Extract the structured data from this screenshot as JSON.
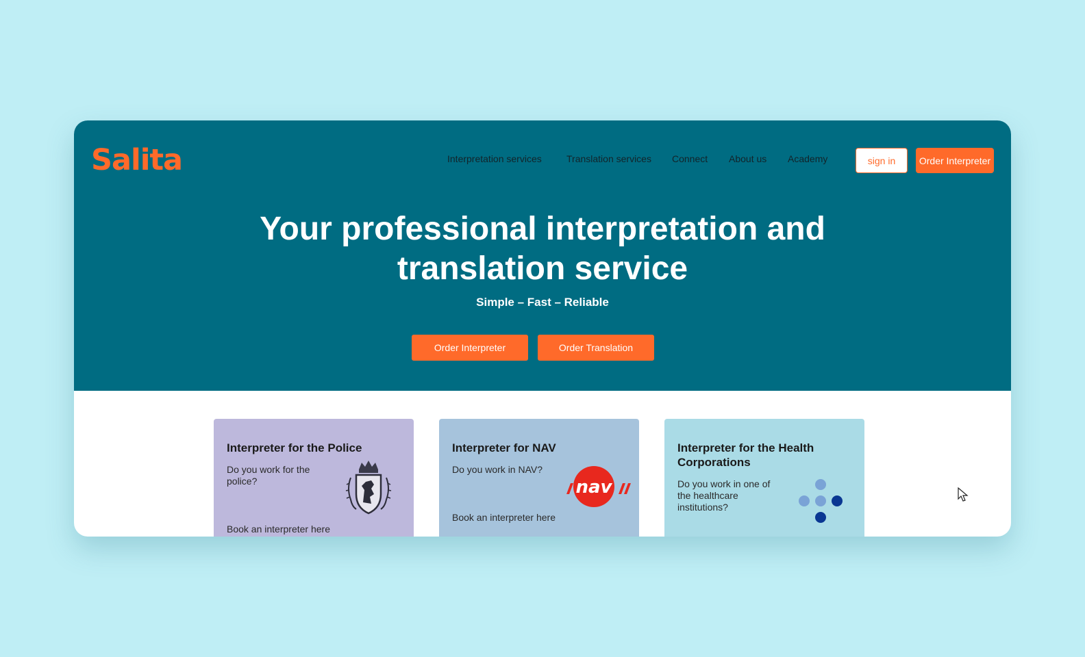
{
  "brand": {
    "name": "Salita",
    "accent": "#ff6a2a",
    "hero_bg": "#006c82"
  },
  "nav": {
    "items": [
      "Interpretation services",
      "Translation services",
      "Connect",
      "About us",
      "Academy"
    ],
    "signin_label": "sign in",
    "order_label": "Order Interpreter"
  },
  "hero": {
    "title_line1": "Your professional interpretation and",
    "title_line2": "translation service",
    "subtitle": "Simple – Fast – Reliable",
    "btn_interpreter": "Order Interpreter",
    "btn_translation": "Order Translation"
  },
  "cards": [
    {
      "title": "Interpreter for the Police",
      "question": "Do you work for the police?",
      "link": "Book an interpreter here",
      "bg": "#bdb8dc",
      "icon": "coat-of-arms-icon"
    },
    {
      "title": "Interpreter for NAV",
      "question": "Do you work in NAV?",
      "link": "Book an interpreter here",
      "bg": "#a6c3dc",
      "icon": "nav-logo-icon"
    },
    {
      "title": "Interpreter for the Health Corporations",
      "question": "Do you work in one of the healthcare institutions?",
      "link": "",
      "bg": "#aadbe6",
      "icon": "dots-logo-icon"
    }
  ]
}
